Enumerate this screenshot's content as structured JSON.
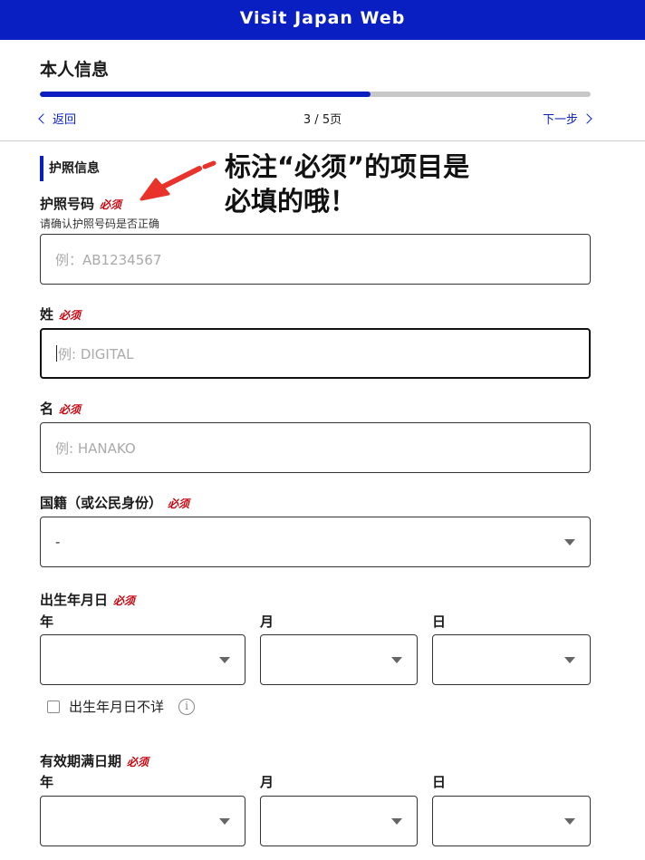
{
  "header": {
    "title": "Visit Japan Web"
  },
  "page": {
    "title": "本人信息",
    "progress": 0.6,
    "back_label": "返回",
    "page_indicator": "3 / 5页",
    "next_label": "下一步"
  },
  "section": {
    "title": "护照信息"
  },
  "required_label": "必须",
  "passport": {
    "label": "护照号码",
    "hint": "请确认护照号码是否正确",
    "placeholder": "例：AB1234567"
  },
  "surname": {
    "label": "姓",
    "placeholder": "例: DIGITAL"
  },
  "given_name": {
    "label": "名",
    "placeholder": "例: HANAKO"
  },
  "nationality": {
    "label": "国籍（或公民身份）",
    "value": "-"
  },
  "birth_date": {
    "label": "出生年月日",
    "year_label": "年",
    "month_label": "月",
    "day_label": "日",
    "unknown_label": "出生年月日不详"
  },
  "expiry_date": {
    "label": "有效期满日期",
    "year_label": "年",
    "month_label": "月",
    "day_label": "日"
  },
  "annotation": {
    "line1": "标注“必须”的项目是",
    "line2": "必填的哦！"
  },
  "colors": {
    "brand": "#0a1fc2",
    "required": "#c8000a",
    "annotation_arrow": "#e8322a"
  }
}
